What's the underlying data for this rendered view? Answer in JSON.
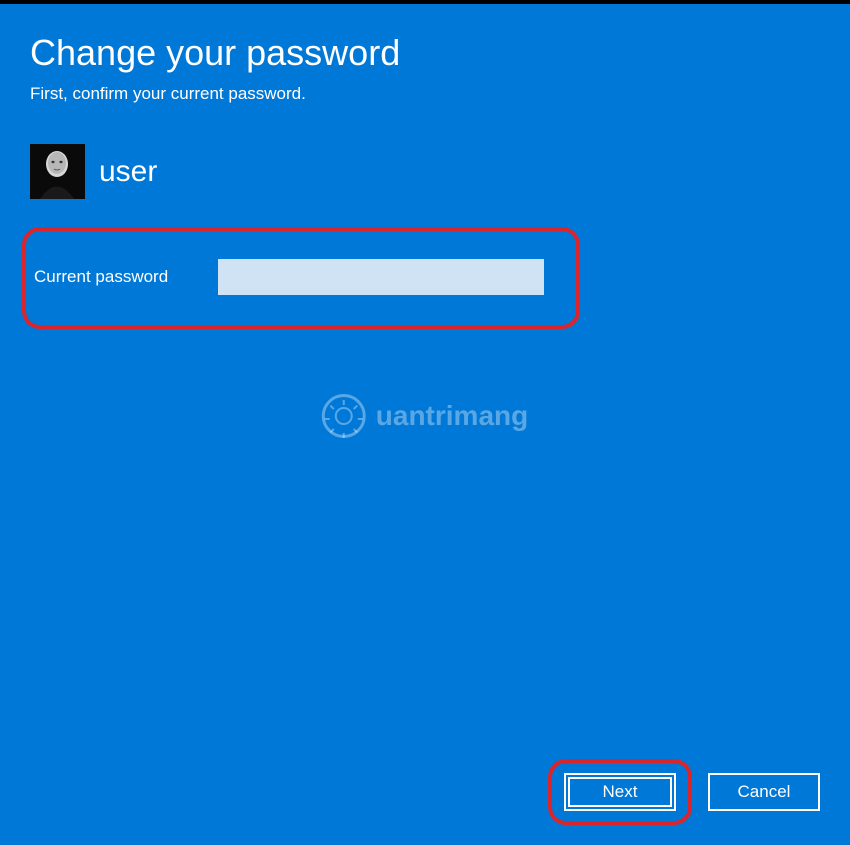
{
  "header": {
    "title": "Change your password",
    "subtitle": "First, confirm your current password."
  },
  "user": {
    "name": "user"
  },
  "form": {
    "current_password_label": "Current password",
    "current_password_value": ""
  },
  "buttons": {
    "next": "Next",
    "cancel": "Cancel"
  },
  "watermark": {
    "text": "uantrimang"
  }
}
